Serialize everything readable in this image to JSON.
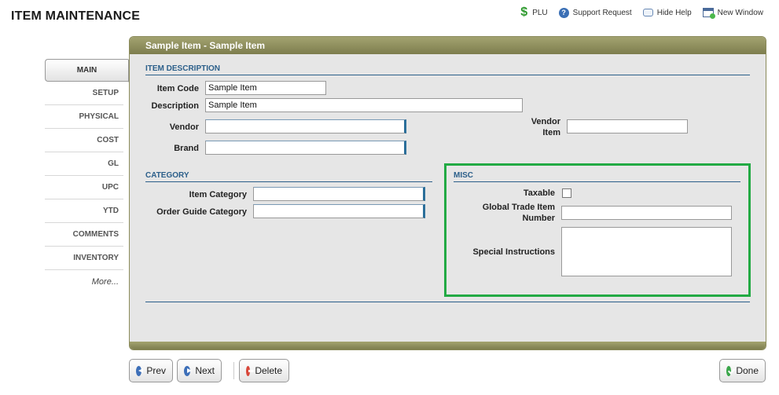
{
  "app": {
    "title": "ITEM MAINTENANCE"
  },
  "top_links": [
    {
      "label": "PLU",
      "icon": "dollar-icon"
    },
    {
      "label": "Support Request",
      "icon": "help-icon"
    },
    {
      "label": "Hide Help",
      "icon": "speech-bubble-icon"
    },
    {
      "label": "New Window",
      "icon": "new-window-icon"
    }
  ],
  "nav": {
    "items": [
      "MAIN",
      "SETUP",
      "PHYSICAL",
      "COST",
      "GL",
      "UPC",
      "YTD",
      "COMMENTS",
      "INVENTORY"
    ],
    "more": "More...",
    "active": "MAIN"
  },
  "panel": {
    "header": "Sample Item - Sample Item"
  },
  "item_description": {
    "title": "ITEM DESCRIPTION",
    "item_code_label": "Item Code",
    "item_code_value": "Sample Item",
    "description_label": "Description",
    "description_value": "Sample Item",
    "vendor_label": "Vendor",
    "vendor_value": "",
    "brand_label": "Brand",
    "brand_value": "",
    "vendor_item_label_1": "Vendor",
    "vendor_item_label_2": "Item",
    "vendor_item_value": ""
  },
  "category": {
    "title": "CATEGORY",
    "item_category_label": "Item Category",
    "item_category_value": "",
    "order_guide_label": "Order Guide Category",
    "order_guide_value": ""
  },
  "misc": {
    "title": "MISC",
    "taxable_label": "Taxable",
    "taxable_checked": false,
    "gtin_label_1": "Global Trade Item",
    "gtin_label_2": "Number",
    "gtin_value": "",
    "special_instructions_label": "Special Instructions",
    "special_instructions_value": "",
    "highlight_color": "#22aa44"
  },
  "buttons": {
    "prev": "Prev",
    "next": "Next",
    "delete": "Delete",
    "done": "Done"
  }
}
